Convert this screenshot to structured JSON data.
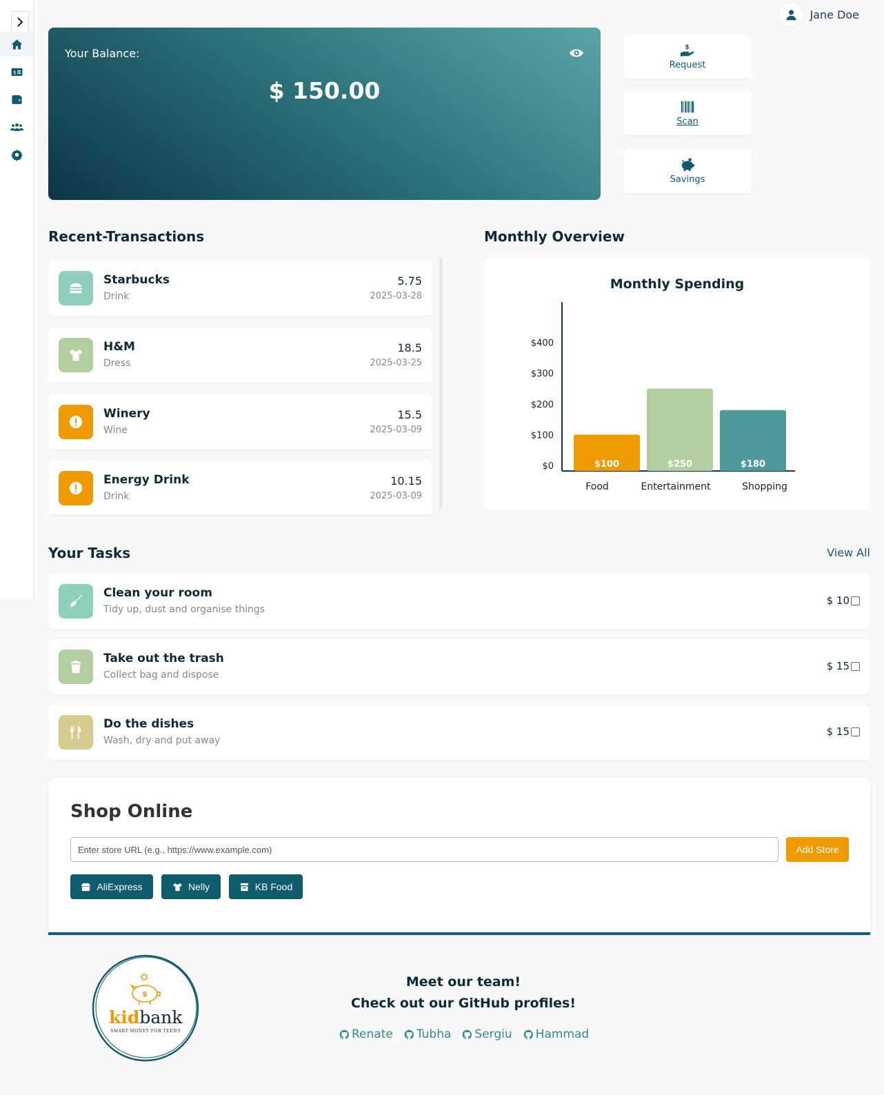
{
  "user": {
    "name": "Jane Doe"
  },
  "balance": {
    "label": "Your Balance:",
    "amount": "$ 150.00"
  },
  "actions": [
    {
      "label": "Request",
      "icon": "hand-dollar-icon"
    },
    {
      "label": "Scan",
      "icon": "barcode-icon"
    },
    {
      "label": "Savings",
      "icon": "piggy-bank-icon"
    }
  ],
  "sidebar": {
    "items": [
      {
        "icon": "home-icon",
        "active": true
      },
      {
        "icon": "money-card-icon"
      },
      {
        "icon": "wallet-icon"
      },
      {
        "icon": "users-icon"
      },
      {
        "icon": "gear-icon"
      }
    ]
  },
  "transactions": {
    "title": "Recent-Transactions",
    "items": [
      {
        "name": "Starbucks",
        "category": "Drink",
        "amount": "5.75",
        "date": "2025-03-28",
        "icon": "burger-icon",
        "color": "#8fd0bd"
      },
      {
        "name": "H&M",
        "category": "Dress",
        "amount": "18.5",
        "date": "2025-03-25",
        "icon": "shirt-icon",
        "color": "#b3cfa1"
      },
      {
        "name": "Winery",
        "category": "Wine",
        "amount": "15.5",
        "date": "2025-03-09",
        "icon": "alert-icon",
        "color": "#ef9a00"
      },
      {
        "name": "Energy Drink",
        "category": "Drink",
        "amount": "10.15",
        "date": "2025-03-09",
        "icon": "alert-icon",
        "color": "#ef9a00"
      }
    ]
  },
  "overview": {
    "title": "Monthly Overview"
  },
  "chart_data": {
    "type": "bar",
    "title": "Monthly Spending",
    "categories": [
      "Food",
      "Entertainment",
      "Shopping"
    ],
    "values": [
      100,
      250,
      180
    ],
    "value_labels": [
      "$100",
      "$250",
      "$180"
    ],
    "colors": [
      "#ef9a00",
      "#b3cfa1",
      "#4e9a9a"
    ],
    "ylim": [
      0,
      500
    ],
    "yticks": [
      0,
      100,
      200,
      300,
      400
    ],
    "ytick_labels": [
      "$0",
      "$100",
      "$200",
      "$300",
      "$400"
    ],
    "xlabel": "",
    "ylabel": "",
    "grid": false
  },
  "tasks": {
    "title": "Your Tasks",
    "view_all": "View All",
    "items": [
      {
        "name": "Clean your room",
        "desc": "Tidy up, dust and organise things",
        "reward": "$ 10",
        "icon": "broom-icon",
        "color": "#8fd0bd"
      },
      {
        "name": "Take out the trash",
        "desc": "Collect bag and dispose",
        "reward": "$ 15",
        "icon": "trash-icon",
        "color": "#b3cfa1"
      },
      {
        "name": "Do the dishes",
        "desc": "Wash, dry and put away",
        "reward": "$ 15",
        "icon": "utensils-icon",
        "color": "#d4cd8e"
      }
    ]
  },
  "shop": {
    "title": "Shop Online",
    "placeholder": "Enter store URL (e.g., https://www.example.com)",
    "add_label": "Add Store",
    "stores": [
      {
        "label": "AliExpress",
        "icon": "box-icon"
      },
      {
        "label": "Nelly",
        "icon": "shirt-icon"
      },
      {
        "label": "KB Food",
        "icon": "store-icon"
      }
    ]
  },
  "footer": {
    "logo_text": "kidbank",
    "logo_tagline": "SMART MONEY FOR TEENS",
    "line1": "Meet our team!",
    "line2": "Check out our GitHub profiles!",
    "profiles": [
      "Renate",
      "Tubha",
      "Sergiu",
      "Hammad"
    ]
  }
}
